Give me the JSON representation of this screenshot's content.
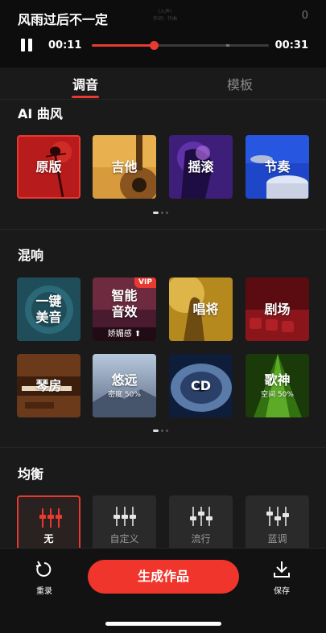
{
  "player": {
    "song_title": "风雨过后不一定",
    "lyric_ghost_line1": "(入声)",
    "lyric_ghost_line2": "作词：作曲",
    "count": "0",
    "current_time": "00:11",
    "total_time": "00:31",
    "progress_fraction": 0.35
  },
  "tabs": [
    {
      "label": "调音",
      "active": true
    },
    {
      "label": "模板",
      "active": false
    }
  ],
  "ai_style": {
    "title": "AI 曲风",
    "items": [
      {
        "label": "原版",
        "selected": true
      },
      {
        "label": "吉他",
        "selected": false
      },
      {
        "label": "摇滚",
        "selected": false
      },
      {
        "label": "节奏",
        "selected": false
      }
    ]
  },
  "reverb": {
    "title": "混响",
    "items": [
      {
        "label_line1": "一键",
        "label_line2": "美音"
      },
      {
        "label_line1": "智能",
        "label_line2": "音效",
        "badge": "VIP",
        "sub": "娇媚感"
      },
      {
        "label_line1": "唱将"
      },
      {
        "label_line1": "剧场"
      },
      {
        "label_line1": "琴房"
      },
      {
        "label_line1": "悠远",
        "sub": "密度 50%"
      },
      {
        "label_line1": "CD"
      },
      {
        "label_line1": "歌神",
        "sub": "空间 50%"
      }
    ]
  },
  "equalizer": {
    "title": "均衡",
    "items": [
      {
        "label": "无",
        "selected": true
      },
      {
        "label": "自定义",
        "selected": false
      },
      {
        "label": "流行",
        "selected": false
      },
      {
        "label": "蓝调",
        "selected": false
      }
    ]
  },
  "bottom_bar": {
    "reset_label": "重录",
    "generate_label": "生成作品",
    "save_label": "保存"
  },
  "colors": {
    "accent": "#e83a30",
    "background": "#1a1a1a"
  }
}
